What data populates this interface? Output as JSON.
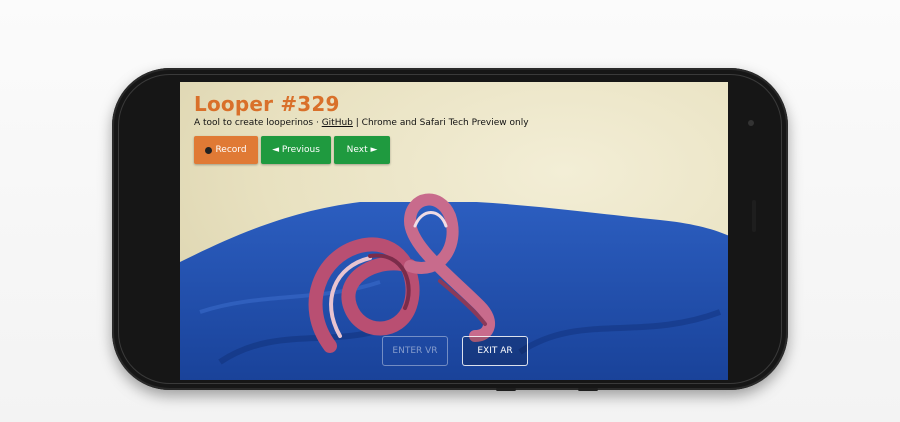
{
  "app": {
    "title": "Looper #329",
    "subtitle_prefix": "A tool to create looperinos · ",
    "github_link": "GitHub",
    "subtitle_suffix": " | Chrome and Safari Tech Preview only"
  },
  "controls": {
    "record_label": "Record",
    "previous_label": "◄ Previous",
    "next_label": "Next ►"
  },
  "xr": {
    "enter_vr_label": "ENTER VR",
    "exit_ar_label": "EXIT AR"
  },
  "colors": {
    "title": "#d9702a",
    "record_button": "#e07a35",
    "nav_button": "#1f9a3f",
    "cloth": "#1f4aa8",
    "sculpture": "#c0607f"
  }
}
